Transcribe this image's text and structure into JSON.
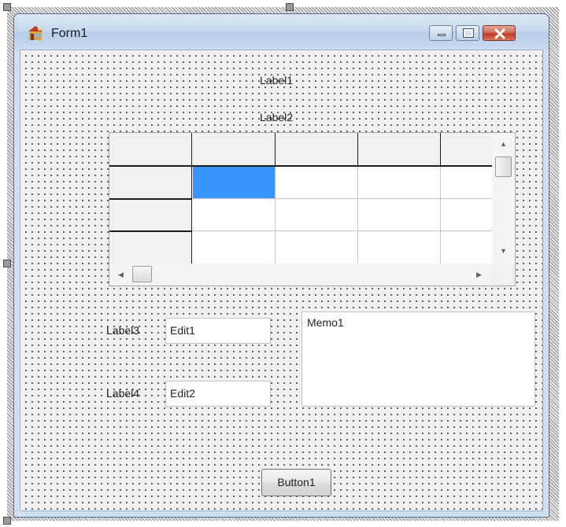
{
  "window": {
    "title": "Form1",
    "icon": "app-icon",
    "caption_buttons": [
      "minimize-icon",
      "maximize-icon",
      "close-icon"
    ]
  },
  "labels": {
    "label1": "Label1",
    "label2": "Label2",
    "label3": "Label3",
    "label4": "Label4"
  },
  "grid": {
    "columns": 5,
    "rows": 4,
    "fixed_rows": 1,
    "fixed_cols": 1,
    "selected_cell": [
      1,
      1
    ],
    "selected_color": "#3a94fd",
    "cells": [
      [
        "",
        "",
        "",
        "",
        ""
      ],
      [
        "",
        "",
        "",
        "",
        ""
      ],
      [
        "",
        "",
        "",
        "",
        ""
      ],
      [
        "",
        "",
        "",
        "",
        ""
      ]
    ]
  },
  "edits": {
    "edit1": "Edit1",
    "edit2": "Edit2"
  },
  "memo": {
    "text": "Memo1"
  },
  "button": {
    "label": "Button1"
  },
  "colors": {
    "window_border": "#4f6f93",
    "client_bg": "#f0f0f0",
    "close_button": "#c0392b"
  }
}
